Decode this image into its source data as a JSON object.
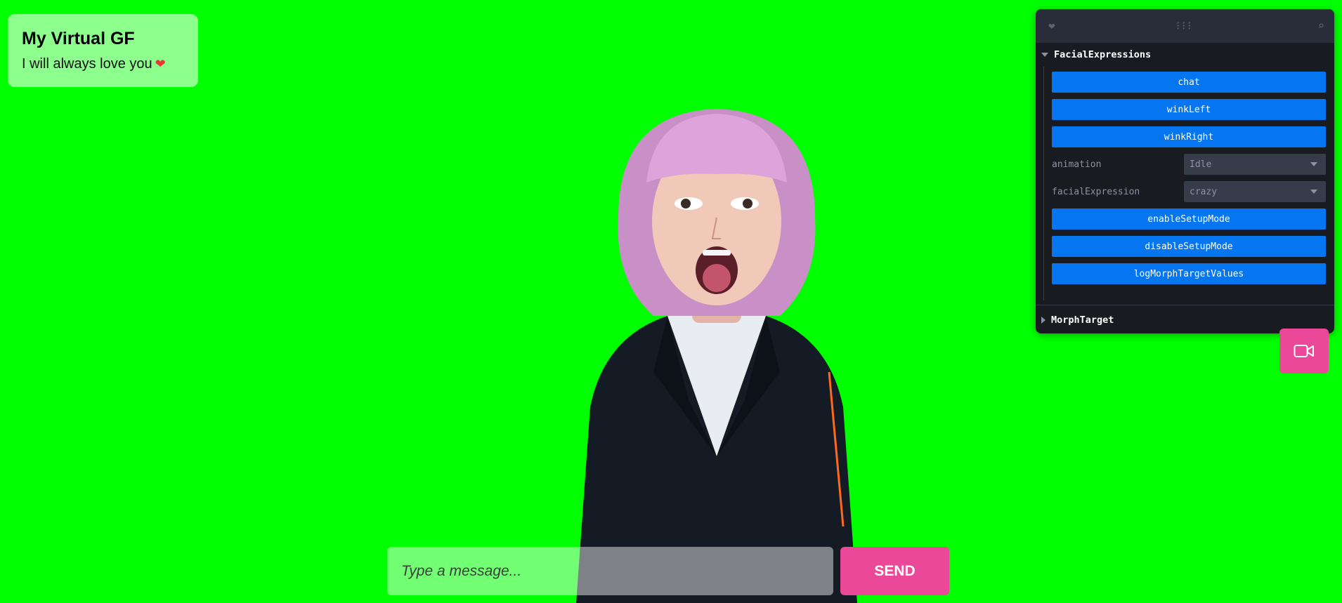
{
  "header": {
    "title": "My Virtual GF",
    "subtitle": "I will always love you",
    "heart_icon": "heart-icon"
  },
  "panel": {
    "folders": [
      {
        "name": "FacialExpressions",
        "expanded": true,
        "buttons": {
          "chat": "chat",
          "wink_left": "winkLeft",
          "wink_right": "winkRight",
          "enable_setup": "enableSetupMode",
          "disable_setup": "disableSetupMode",
          "log_morph": "logMorphTargetValues"
        },
        "fields": {
          "animation": {
            "label": "animation",
            "value": "Idle"
          },
          "facial_expression": {
            "label": "facialExpression",
            "value": "crazy"
          }
        }
      },
      {
        "name": "MorphTarget",
        "expanded": false
      }
    ],
    "colors": {
      "button": "#0576f0",
      "panel_bg": "#181c20"
    }
  },
  "chat": {
    "placeholder": "Type a message...",
    "send_label": "SEND",
    "accent": "#ec4899"
  },
  "background": "#00ff00"
}
